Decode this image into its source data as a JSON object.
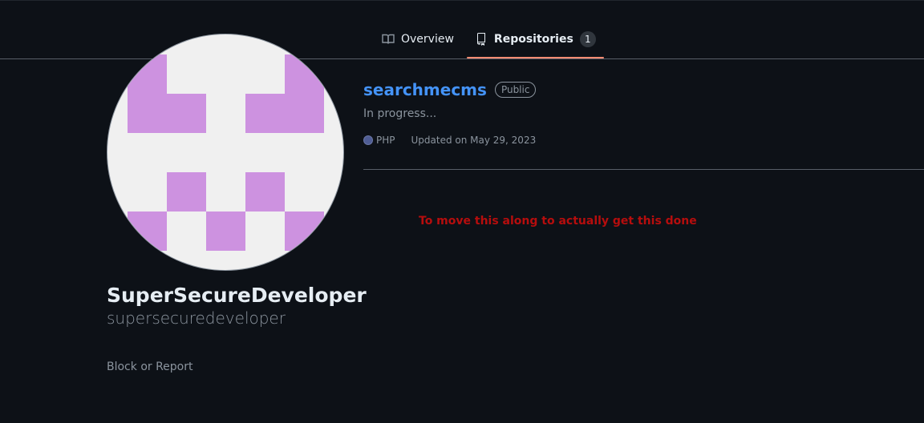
{
  "tabs": [
    {
      "label": "Overview",
      "icon": "book-icon",
      "active": false
    },
    {
      "label": "Repositories",
      "icon": "repo-icon",
      "active": true,
      "count": "1"
    }
  ],
  "profile": {
    "fullname": "SuperSecureDeveloper",
    "username": "supersecuredeveloper",
    "block_report": "Block or Report",
    "avatar_color": "#cd92e0"
  },
  "repo": {
    "name": "searchmecms",
    "visibility": "Public",
    "description": "In progress...",
    "language": "PHP",
    "language_color": "#4f5d95",
    "updated": "Updated on May 29, 2023"
  },
  "annotation": "To move this along to actually get this done",
  "colors": {
    "background": "#0d1117",
    "link": "#4493f8",
    "tab_accent": "#fd8c73",
    "annotation": "#b60d0d"
  }
}
